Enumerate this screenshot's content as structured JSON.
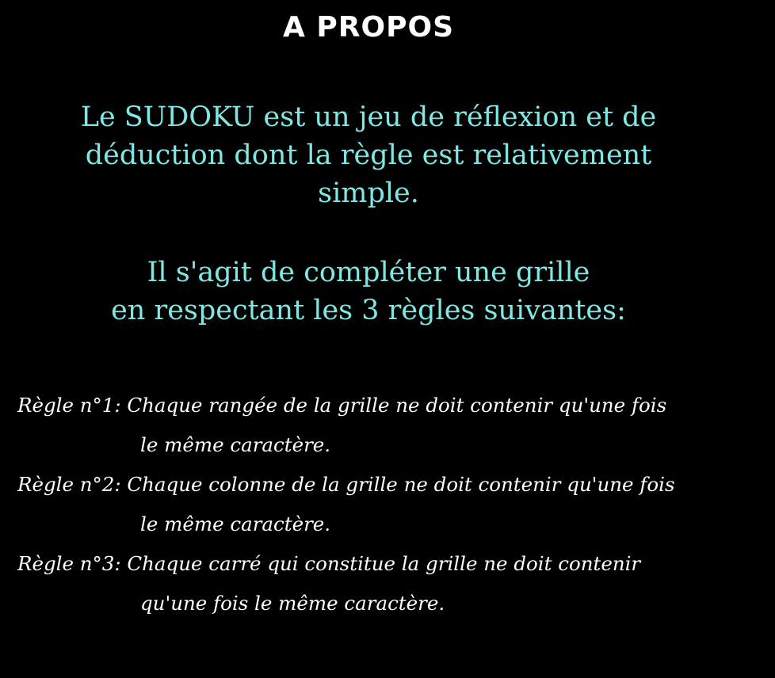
{
  "page_title": "A PROPOS",
  "intro": {
    "p1_line1": "Le SUDOKU est un jeu de réflexion et de",
    "p1_line2": "déduction dont la règle est relativement",
    "p1_line3": "simple.",
    "p2_line1": "Il s'agit de compléter une grille",
    "p2_line2": "en respectant les 3 règles suivantes:"
  },
  "rules": [
    {
      "line1": "Règle n°1: Chaque rangée de la grille ne doit contenir qu'une fois",
      "line2": "le même caractère."
    },
    {
      "line1": "Règle n°2: Chaque colonne de la grille ne doit contenir qu'une fois",
      "line2": "le même caractère."
    },
    {
      "line1": "Règle n°3: Chaque carré qui constitue la grille ne doit contenir",
      "line2": "qu'une fois le même caractère."
    }
  ],
  "colors": {
    "background": "#000000",
    "intro_text": "#7fe8e4",
    "title_text": "#ffffff",
    "rules_text": "#ffffff"
  }
}
